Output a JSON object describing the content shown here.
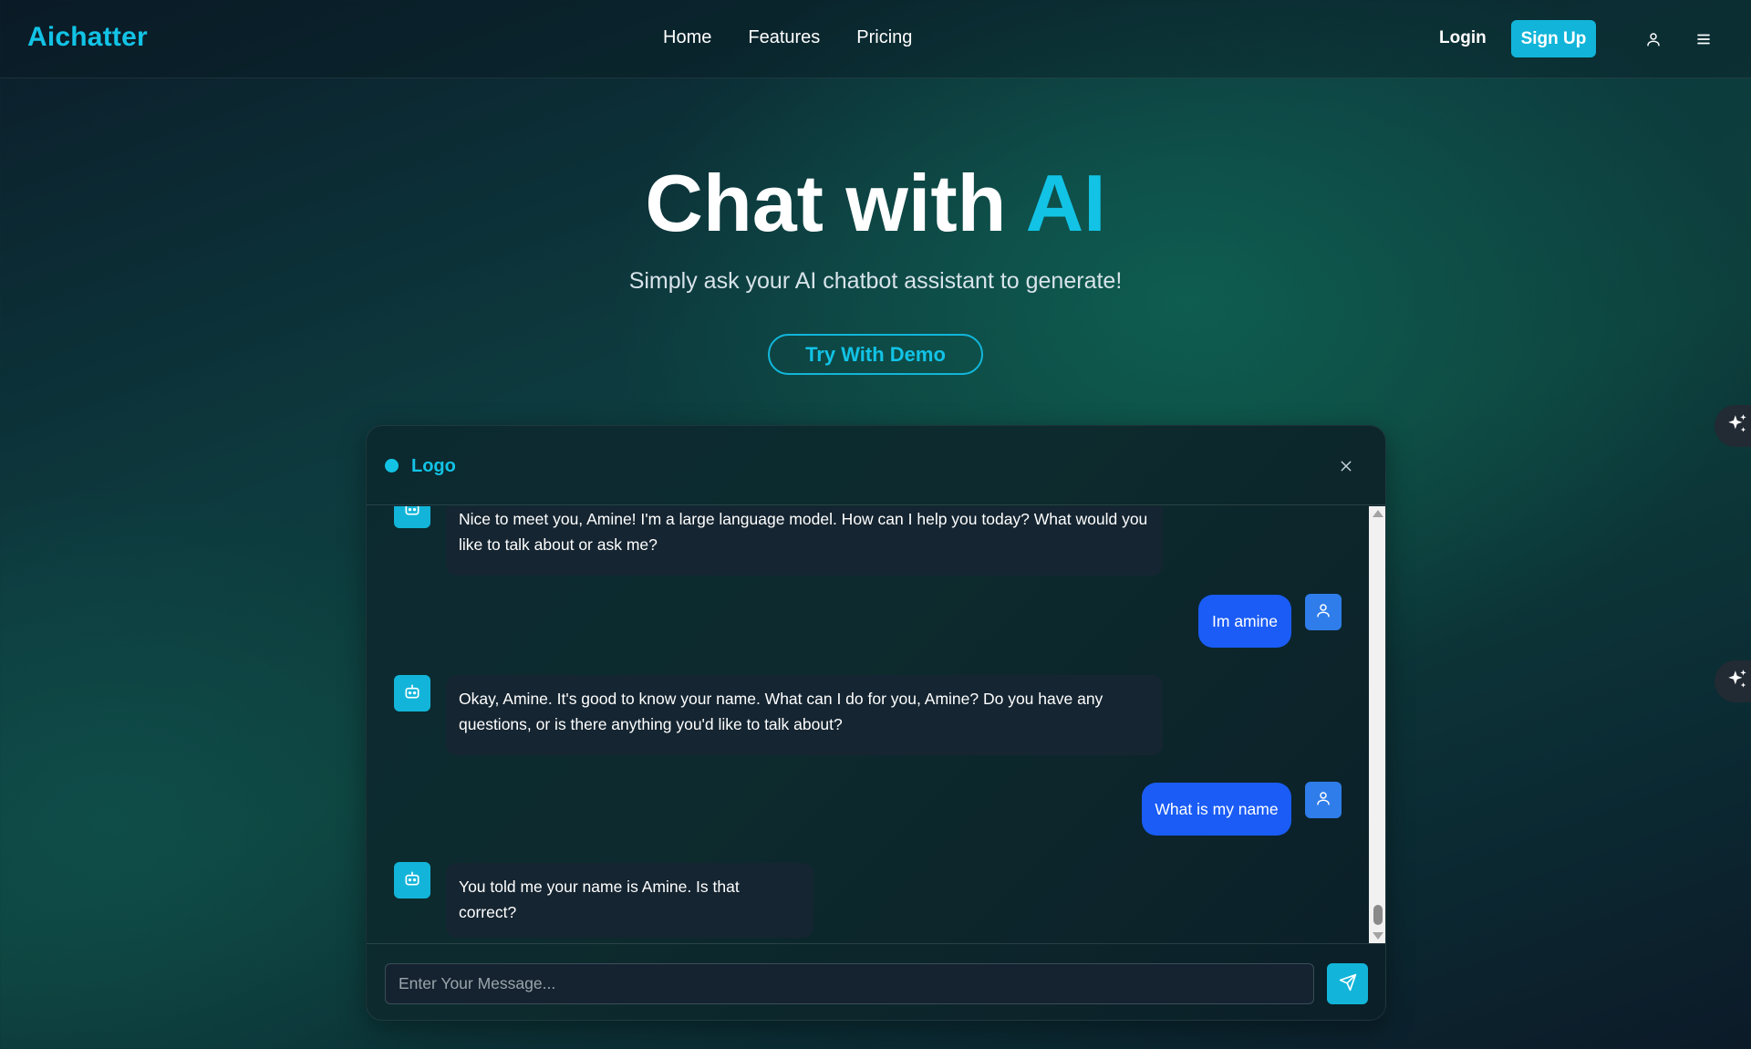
{
  "navbar": {
    "brand": "Aichatter",
    "links": [
      {
        "label": "Home"
      },
      {
        "label": "Features"
      },
      {
        "label": "Pricing"
      }
    ],
    "login_label": "Login",
    "signup_label": "Sign Up",
    "icons": [
      "user-icon",
      "menu-icon"
    ]
  },
  "hero": {
    "title_main": "Chat with ",
    "title_accent": "AI",
    "subtitle": "Simply ask your AI chatbot assistant to generate!",
    "demo_button": "Try With Demo"
  },
  "floating_buttons": [
    {
      "icon": "sparkles-icon"
    },
    {
      "icon": "sparkles-icon"
    }
  ],
  "chat": {
    "header_title": "Logo",
    "close_icon": "close-icon",
    "messages": [
      {
        "role": "bot",
        "line1": "Nice to meet you, Amine! I'm a large language model. How can I help you today? What would you",
        "line2": "like to talk about or ask me?"
      },
      {
        "role": "user",
        "text": "Im amine"
      },
      {
        "role": "bot",
        "line1": "Okay, Amine. It's good to know your name. What can I do for you, Amine? Do you have any",
        "line2": "questions, or is there anything you'd like to talk about?"
      },
      {
        "role": "user",
        "text": "What is my name"
      },
      {
        "role": "bot",
        "line1": "You told me your name is Amine. Is that correct?"
      }
    ],
    "input_placeholder": "Enter Your Message...",
    "input_value": "",
    "send_icon": "send-icon"
  },
  "colors": {
    "accent": "#12c3e6",
    "user_bubble": "#1a5cf5",
    "bot_bubble": "#152531"
  }
}
